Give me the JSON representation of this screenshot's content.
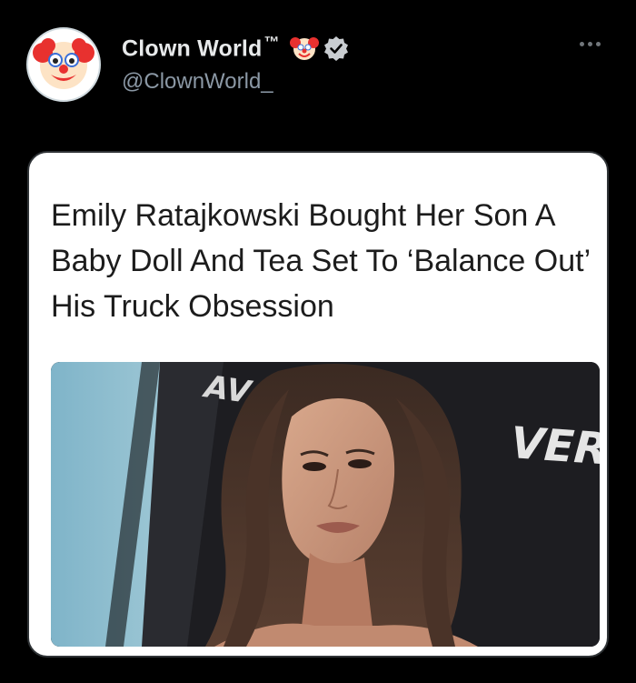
{
  "tweet": {
    "display_name": "Clown World",
    "trademark": "™",
    "handle": "@ClownWorld_",
    "icons": [
      "clown-avatar-icon",
      "clown-face-icon",
      "verified-badge-icon",
      "more-options-icon"
    ],
    "colors": {
      "background": "#000000",
      "name": "#e7e9ea",
      "handle": "#8b98a5",
      "verified": "#c9cdd1"
    }
  },
  "card": {
    "headline": "Emily Ratajkowski Bought Her Son A Baby Doll And Tea Set To ‘Balance Out’ His Truck Obsession",
    "photo": {
      "backdrop_text_left": "AV",
      "backdrop_text_right": "VER"
    }
  }
}
